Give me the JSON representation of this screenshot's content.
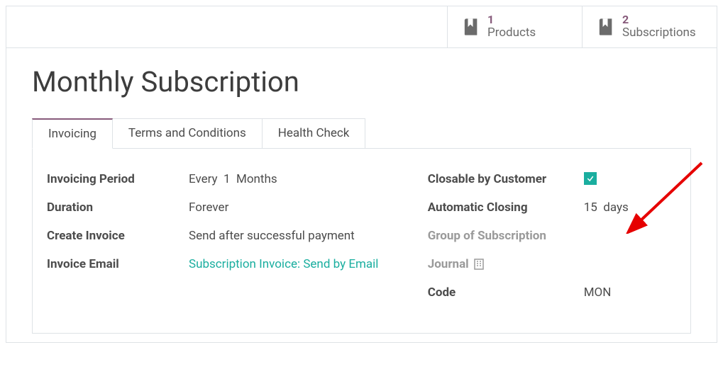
{
  "stats": {
    "products": {
      "count": "1",
      "label": "Products"
    },
    "subscriptions": {
      "count": "2",
      "label": "Subscriptions"
    }
  },
  "title": "Monthly Subscription",
  "tabs": {
    "invoicing": "Invoicing",
    "terms": "Terms and Conditions",
    "health": "Health Check"
  },
  "left": {
    "invoicing_period": {
      "label": "Invoicing Period",
      "value_prefix": "Every",
      "value_num": "1",
      "value_unit": "Months"
    },
    "duration": {
      "label": "Duration",
      "value": "Forever"
    },
    "create_invoice": {
      "label": "Create Invoice",
      "value": "Send after successful payment"
    },
    "invoice_email": {
      "label": "Invoice Email",
      "value": "Subscription Invoice: Send by Email"
    }
  },
  "right": {
    "closable": {
      "label": "Closable by Customer",
      "checked": true
    },
    "auto_closing": {
      "label": "Automatic Closing",
      "value_num": "15",
      "value_unit": "days"
    },
    "group_sub": {
      "label": "Group of Subscription"
    },
    "journal": {
      "label": "Journal"
    },
    "code": {
      "label": "Code",
      "value": "MON"
    }
  }
}
